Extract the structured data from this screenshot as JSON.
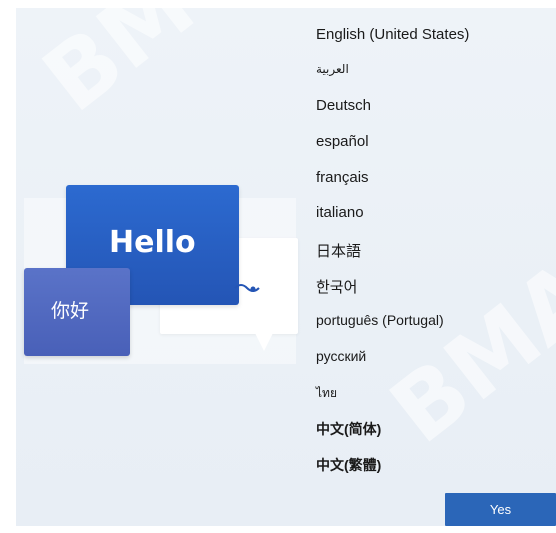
{
  "illustration": {
    "hello_text": "Hello",
    "nihao_text": "你好"
  },
  "watermark": {
    "text_left": "BM",
    "text_right": "BMA"
  },
  "languages": [
    {
      "label": "English (United States)"
    },
    {
      "label": "العربية"
    },
    {
      "label": "Deutsch"
    },
    {
      "label": "español"
    },
    {
      "label": "français"
    },
    {
      "label": "italiano"
    },
    {
      "label": "日本語"
    },
    {
      "label": "한국어"
    },
    {
      "label": "português (Portugal)"
    },
    {
      "label": "русский"
    },
    {
      "label": "ไทย"
    },
    {
      "label": "中文(简体)"
    },
    {
      "label": "中文(繁體)"
    }
  ],
  "actions": {
    "yes_label": "Yes"
  },
  "colors": {
    "accent": "#2b66b8",
    "hello_card": "#2a62c8",
    "nihao_card": "#5169bf",
    "panel_bg": "#edf2f7"
  }
}
